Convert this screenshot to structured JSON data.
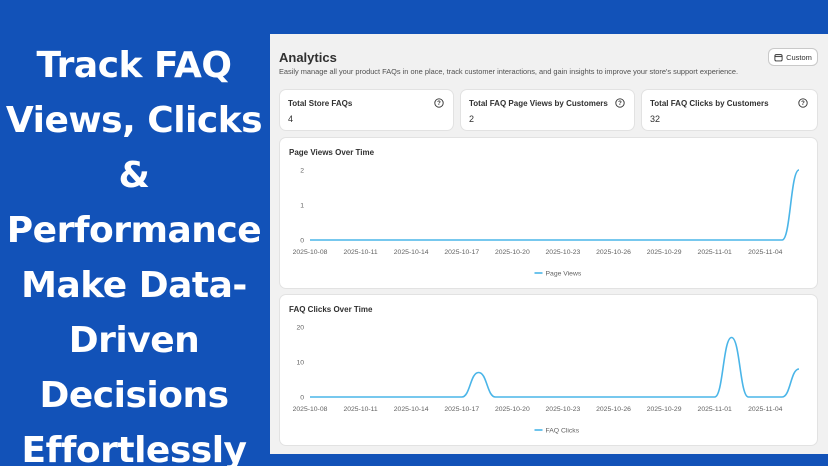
{
  "promo": {
    "lines": [
      "Track FAQ",
      "Views, Clicks",
      "&",
      "Performance",
      "Make Data-",
      "Driven",
      "Decisions",
      "Effortlessly"
    ]
  },
  "analytics": {
    "title": "Analytics",
    "subtitle": "Easily manage all your product FAQs in one place, track customer interactions, and gain insights to improve your store's support experience.",
    "custom_button": "Custom",
    "icons": {
      "custom_button": "calendar-icon",
      "stat_help": "question-circle-icon"
    },
    "accent_color": "#4ab5e8",
    "stats": [
      {
        "label": "Total Store FAQs",
        "value": "4"
      },
      {
        "label": "Total FAQ Page Views by Customers",
        "value": "2"
      },
      {
        "label": "Total FAQ Clicks by Customers",
        "value": "32"
      }
    ]
  },
  "chart_data": [
    {
      "type": "line",
      "title": "Page Views Over Time",
      "x": [
        "2025-10-08",
        "2025-10-09",
        "2025-10-10",
        "2025-10-11",
        "2025-10-12",
        "2025-10-13",
        "2025-10-14",
        "2025-10-15",
        "2025-10-16",
        "2025-10-17",
        "2025-10-18",
        "2025-10-19",
        "2025-10-20",
        "2025-10-21",
        "2025-10-22",
        "2025-10-23",
        "2025-10-24",
        "2025-10-25",
        "2025-10-26",
        "2025-10-27",
        "2025-10-28",
        "2025-10-29",
        "2025-10-30",
        "2025-10-31",
        "2025-11-01",
        "2025-11-02",
        "2025-11-03",
        "2025-11-04",
        "2025-11-05",
        "2025-11-06"
      ],
      "x_ticks": [
        "2025-10-08",
        "2025-10-11",
        "2025-10-14",
        "2025-10-17",
        "2025-10-20",
        "2025-10-23",
        "2025-10-26",
        "2025-10-29",
        "2025-11-01",
        "2025-11-04"
      ],
      "ylim": [
        0,
        2
      ],
      "y_ticks": [
        0,
        1,
        2
      ],
      "series": [
        {
          "name": "Page Views",
          "color": "#4ab5e8",
          "values": [
            0,
            0,
            0,
            0,
            0,
            0,
            0,
            0,
            0,
            0,
            0,
            0,
            0,
            0,
            0,
            0,
            0,
            0,
            0,
            0,
            0,
            0,
            0,
            0,
            0,
            0,
            0,
            0,
            0,
            2
          ]
        }
      ],
      "legend": "bottom-center",
      "grid": false
    },
    {
      "type": "line",
      "title": "FAQ Clicks Over Time",
      "x": [
        "2025-10-08",
        "2025-10-09",
        "2025-10-10",
        "2025-10-11",
        "2025-10-12",
        "2025-10-13",
        "2025-10-14",
        "2025-10-15",
        "2025-10-16",
        "2025-10-17",
        "2025-10-18",
        "2025-10-19",
        "2025-10-20",
        "2025-10-21",
        "2025-10-22",
        "2025-10-23",
        "2025-10-24",
        "2025-10-25",
        "2025-10-26",
        "2025-10-27",
        "2025-10-28",
        "2025-10-29",
        "2025-10-30",
        "2025-10-31",
        "2025-11-01",
        "2025-11-02",
        "2025-11-03",
        "2025-11-04",
        "2025-11-05",
        "2025-11-06"
      ],
      "x_ticks": [
        "2025-10-08",
        "2025-10-11",
        "2025-10-14",
        "2025-10-17",
        "2025-10-20",
        "2025-10-23",
        "2025-10-26",
        "2025-10-29",
        "2025-11-01",
        "2025-11-04"
      ],
      "ylim": [
        0,
        20
      ],
      "y_ticks": [
        0,
        10,
        20
      ],
      "series": [
        {
          "name": "FAQ Clicks",
          "color": "#4ab5e8",
          "values": [
            0,
            0,
            0,
            0,
            0,
            0,
            0,
            0,
            0,
            0,
            7,
            0,
            0,
            0,
            0,
            0,
            0,
            0,
            0,
            0,
            0,
            0,
            0,
            0,
            0,
            17,
            0,
            0,
            0,
            8
          ]
        }
      ],
      "legend": "bottom-center",
      "grid": false
    }
  ]
}
